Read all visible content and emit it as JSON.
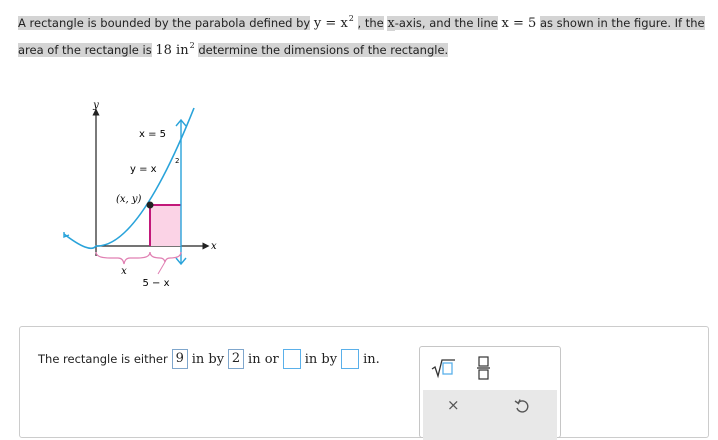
{
  "question": {
    "seg1": "A rectangle is bounded by the parabola defined by",
    "eq1_lhs": "y",
    "eq1_op": "=",
    "eq1_base": "x",
    "eq1_exp": "2",
    "seg2": ", the",
    "xaxis_var": "x",
    "seg3": "-axis, and the line",
    "eq2_lhs": "x",
    "eq2_op": "=",
    "eq2_rhs": "5",
    "seg4": "as shown in the figure. If the",
    "seg5": "area of the rectangle is",
    "area_value": "18",
    "area_unit": "in",
    "area_exp": "2",
    "seg6": "determine the dimensions of the rectangle."
  },
  "figure": {
    "y_axis_label": "y",
    "x_axis_label": "x",
    "line_label": "x = 5",
    "curve_label_lhs": "y = x",
    "curve_label_exp": "2",
    "point_label": "(x, y)",
    "width_label": "x",
    "remainder_label": "5 − x",
    "colors": {
      "curve": "#29a3da",
      "rectangle_edge": "#c2187a",
      "rectangle_fill": "#fbd3e6",
      "axis": "#222222",
      "brace": "#e07fb2"
    }
  },
  "answer": {
    "prefix": "The rectangle is either",
    "box1": "9",
    "unit_by": "in by",
    "box2": "2",
    "unit_or": "in or",
    "box3": "",
    "unit_by2": "in by",
    "box4": "",
    "unit_end": "in."
  },
  "mathpad": {
    "sqrt_icon": "square-root-icon",
    "fraction_icon": "fraction-icon",
    "clear_icon": "clear-icon",
    "undo_icon": "undo-icon",
    "clear_glyph": "×"
  }
}
